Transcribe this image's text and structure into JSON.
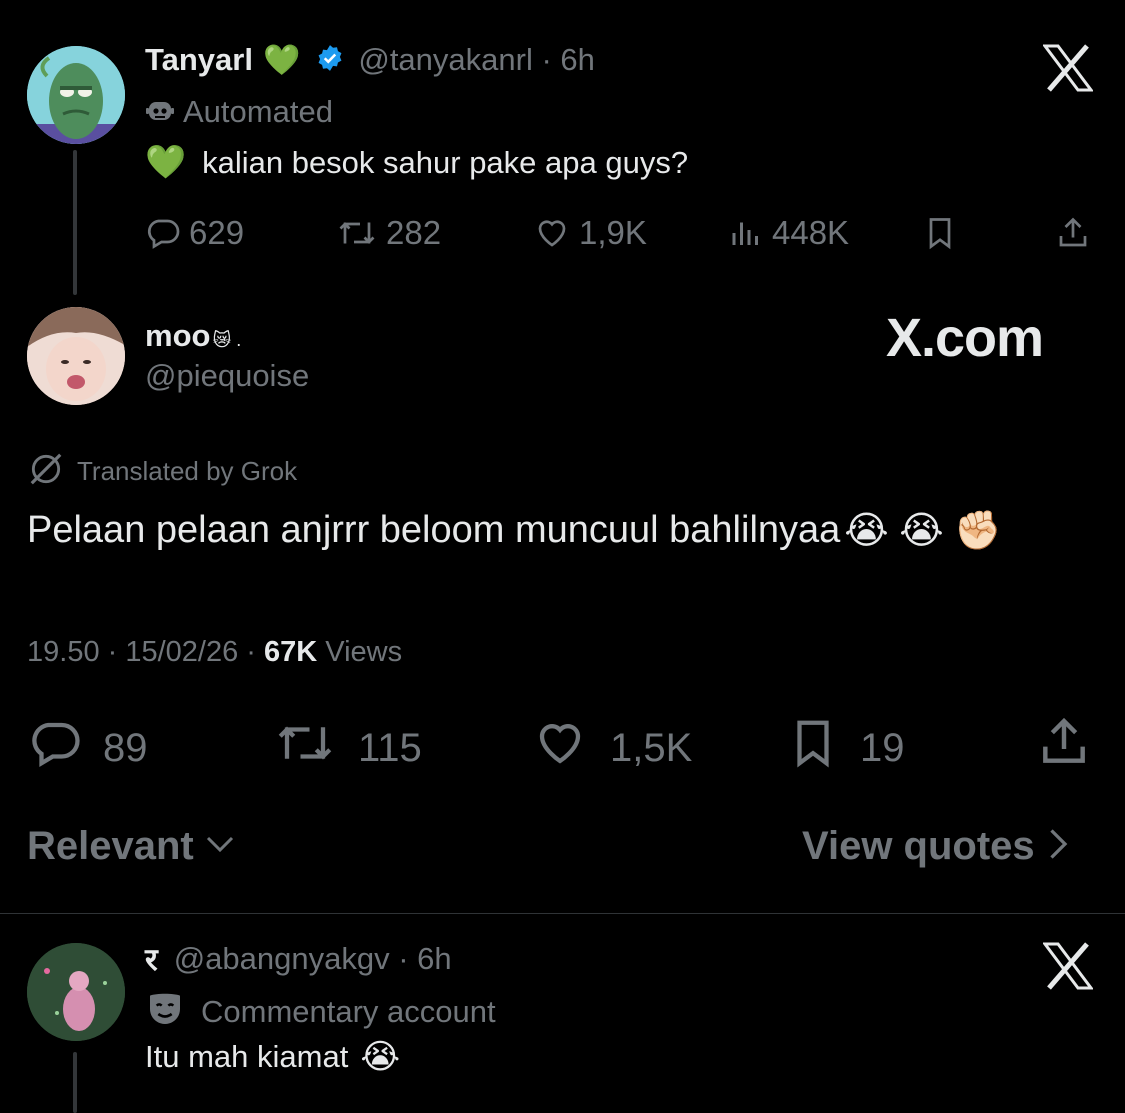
{
  "colors": {
    "background": "#000000",
    "text": "#e7e9ea",
    "muted": "#71767b",
    "verified": "#1d9bf0"
  },
  "tweet1": {
    "name": "Tanyarl",
    "name_emoji": "💚",
    "handle_time": "@tanyakanrl · 6h",
    "label_icon": "robot-icon",
    "label": "Automated",
    "text_emoji": "💚",
    "text": "kalian besok sahur pake apa guys?",
    "stats": {
      "replies": "629",
      "reposts": "282",
      "likes": "1,9K",
      "views": "448K"
    }
  },
  "tweet2": {
    "name": "moo",
    "name_suffix": "😿 .",
    "handle": "@piequoise",
    "watermark": "X.com",
    "translated_label": "Translated by Grok",
    "text": "Pelaan pelaan anjrrr beloom muncuul bahlilnyaa",
    "text_emojis": "😭 😭 ✊🏻",
    "meta": {
      "time": "19.50 · 15/02/26 · ",
      "views_count": "67K",
      "views_label": " Views"
    },
    "stats": {
      "replies": "89",
      "reposts": "115",
      "likes": "1,5K",
      "bookmarks": "19"
    }
  },
  "filter": {
    "sort_label": "Relevant",
    "quotes_label": "View quotes"
  },
  "reply1": {
    "name": "र",
    "handle_time": "@abangnyakgv · 6h",
    "label_icon": "theater-masks-icon",
    "label": "Commentary account",
    "text": "Itu mah kiamat",
    "text_emoji": "😭"
  }
}
